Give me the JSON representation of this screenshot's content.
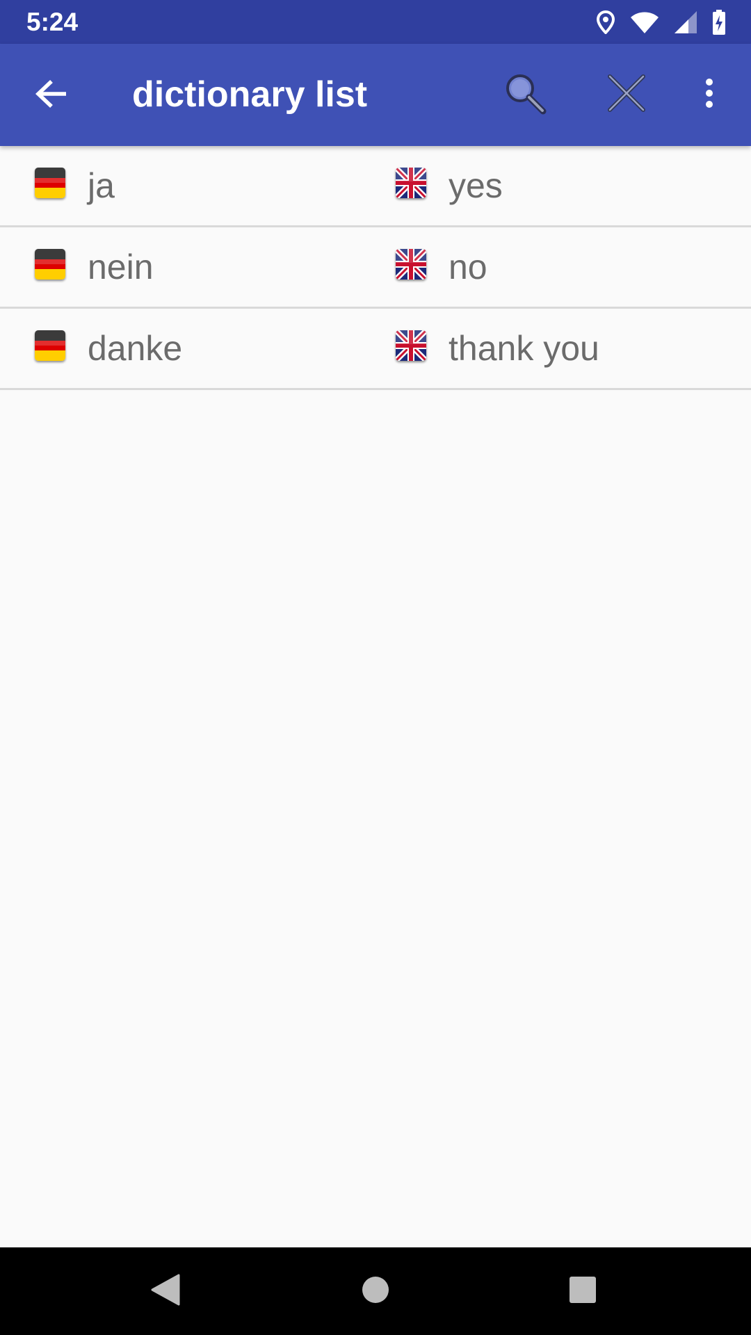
{
  "status_bar": {
    "time": "5:24",
    "icons": [
      "location-icon",
      "wifi-icon",
      "signal-icon",
      "battery-charging-icon"
    ]
  },
  "app_bar": {
    "title": "dictionary list",
    "back_icon": "arrow-back-icon",
    "actions": [
      "search-icon",
      "close-icon",
      "more-vert-icon"
    ]
  },
  "entries": [
    {
      "source_flag": "german-flag-icon",
      "source": "ja",
      "target_flag": "uk-flag-icon",
      "target": "yes"
    },
    {
      "source_flag": "german-flag-icon",
      "source": "nein",
      "target_flag": "uk-flag-icon",
      "target": "no"
    },
    {
      "source_flag": "german-flag-icon",
      "source": "danke",
      "target_flag": "uk-flag-icon",
      "target": "thank you"
    }
  ],
  "nav_bar": {
    "buttons": [
      "nav-back-icon",
      "nav-home-icon",
      "nav-recents-icon"
    ]
  },
  "colors": {
    "status_bar": "#303f9f",
    "app_bar": "#3f51b5",
    "background": "#fafafa",
    "word_text": "#6b6b6b",
    "divider": "#d9d9d9"
  }
}
